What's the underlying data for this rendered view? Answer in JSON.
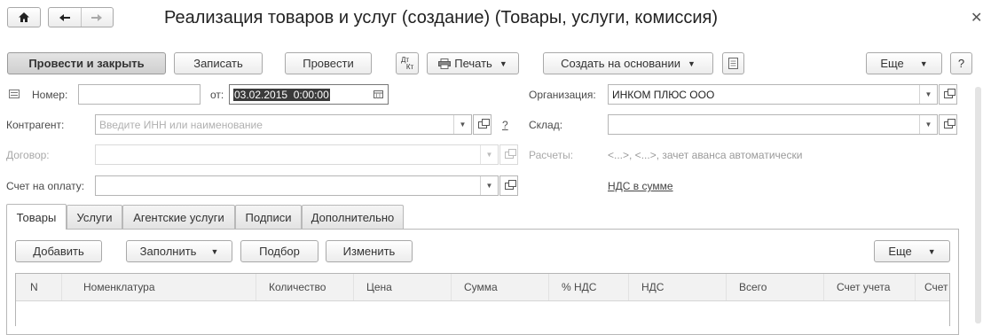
{
  "window": {
    "title": "Реализация товаров и услуг (создание) (Товары, услуги, комиссия)"
  },
  "toolbar": {
    "post_and_close": "Провести и закрыть",
    "save": "Записать",
    "post": "Провести",
    "dt_kt_top": "Дт",
    "dt_kt_bottom": "Кт",
    "print": "Печать",
    "create_based_on": "Создать на основании",
    "more": "Еще",
    "help": "?"
  },
  "form": {
    "number_label": "Номер:",
    "number_value": "",
    "date_label": "от:",
    "date_value": "03.02.2015  0:00:00",
    "organization_label": "Организация:",
    "organization_value": "ИНКОМ ПЛЮС ООО",
    "counterparty_label": "Контрагент:",
    "counterparty_placeholder": "Введите ИНН или наименование",
    "counterparty_help": "?",
    "warehouse_label": "Склад:",
    "warehouse_value": "",
    "contract_label": "Договор:",
    "contract_value": "",
    "settlements_label": "Расчеты:",
    "settlements_value": "<...>, <...>, зачет аванса автоматически",
    "invoice_label": "Счет на оплату:",
    "invoice_value": "",
    "vat_link": "НДС в сумме"
  },
  "tabs": [
    "Товары",
    "Услуги",
    "Агентские услуги",
    "Подписи",
    "Дополнительно"
  ],
  "table_toolbar": {
    "add": "Добавить",
    "fill": "Заполнить",
    "pick": "Подбор",
    "change": "Изменить",
    "more": "Еще"
  },
  "table": {
    "columns": [
      "N",
      "Номенклатура",
      "Количество",
      "Цена",
      "Сумма",
      "% НДС",
      "НДС",
      "Всего",
      "Счет учета",
      "Счет"
    ],
    "rows": []
  }
}
